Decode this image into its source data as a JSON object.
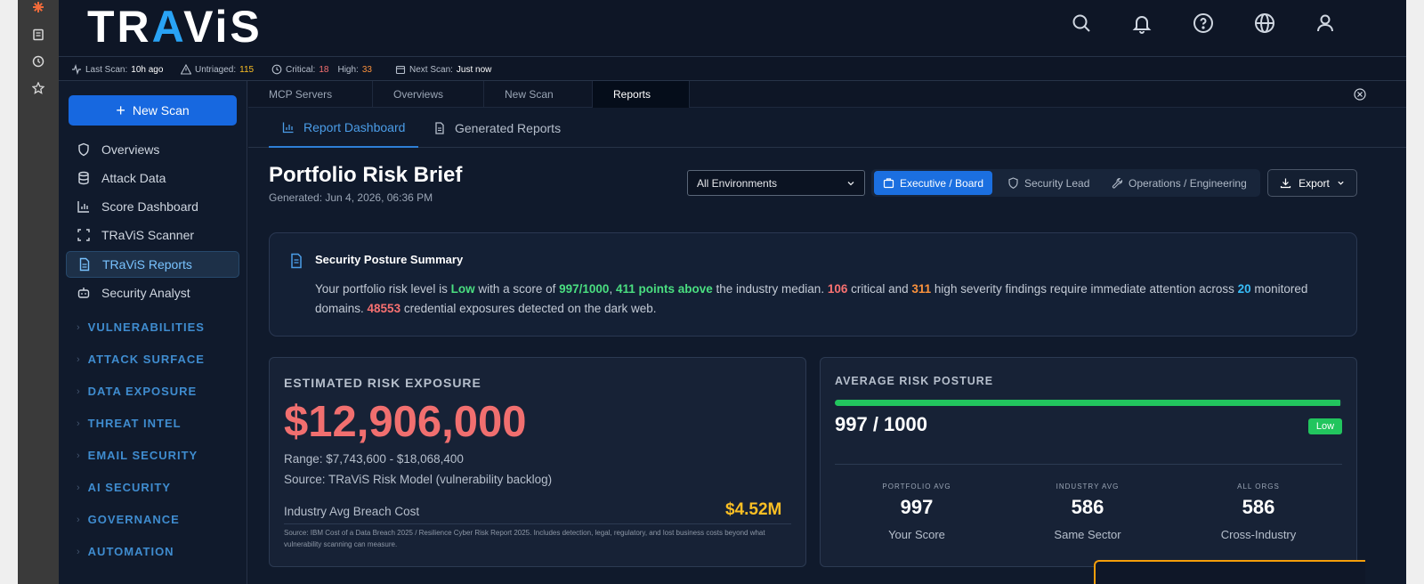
{
  "app": {
    "logo_left": "TR",
    "logo_accent": "A",
    "logo_right": "ViS"
  },
  "icons": {
    "rail": [
      "brand-star-icon",
      "document-icon",
      "clock-icon",
      "star-icon"
    ],
    "top": [
      "search-icon",
      "bell-icon",
      "help-icon",
      "globe-icon",
      "user-icon"
    ]
  },
  "statusbar": {
    "last_scan_label": "Last Scan:",
    "last_scan_value": "10h ago",
    "untriaged_label": "Untriaged:",
    "untriaged_value": "115",
    "critical_label": "Critical:",
    "critical_value": "18",
    "high_label": "High:",
    "high_value": "33",
    "next_scan_label": "Next Scan:",
    "next_scan_value": "Just now"
  },
  "sidebar": {
    "new_scan": "New Scan",
    "items": [
      {
        "label": "Overviews",
        "icon": "shield-icon"
      },
      {
        "label": "Attack Data",
        "icon": "database-icon"
      },
      {
        "label": "Score Dashboard",
        "icon": "chart-icon"
      },
      {
        "label": "TRaViS Scanner",
        "icon": "scan-frame-icon"
      },
      {
        "label": "TRaViS Reports",
        "icon": "report-icon",
        "active": true
      },
      {
        "label": "Security Analyst",
        "icon": "bot-icon"
      }
    ],
    "sections": [
      "VULNERABILITIES",
      "ATTACK SURFACE",
      "DATA EXPOSURE",
      "THREAT INTEL",
      "EMAIL SECURITY",
      "AI SECURITY",
      "GOVERNANCE",
      "AUTOMATION"
    ]
  },
  "tabs": [
    "MCP Servers",
    "Overviews",
    "New Scan",
    "Reports"
  ],
  "subtabs": [
    "Report Dashboard",
    "Generated Reports"
  ],
  "page": {
    "title": "Portfolio Risk Brief",
    "generated": "Generated: Jun 4, 2026, 06:36 PM",
    "env_select": "All Environments",
    "views": [
      "Executive / Board",
      "Security Lead",
      "Operations / Engineering"
    ],
    "export": "Export"
  },
  "summary": {
    "title": "Security Posture Summary",
    "t1": "Your portfolio risk level is ",
    "risk_level": "Low",
    "t2": " with a score of ",
    "score": "997/1000",
    "t3": ", ",
    "above": "411 points above",
    "t4": " the industry median. ",
    "critical": "106",
    "t5": " critical and ",
    "high": "311",
    "t6": " high severity findings require immediate attention across ",
    "domains": "20",
    "t7": " monitored domains. ",
    "exposures": "48553",
    "t8": " credential exposures detected on the dark web."
  },
  "exposure_card": {
    "label": "ESTIMATED RISK EXPOSURE",
    "amount": "$12,906,000",
    "range": "Range: $7,743,600 - $18,068,400",
    "source": "Source: TRaViS Risk Model (vulnerability backlog)",
    "industry_label": "Industry Avg Breach Cost",
    "industry_value": "$4.52M",
    "note": "Source: IBM Cost of a Data Breach 2025 / Resilience Cyber Risk Report 2025. Includes detection, legal, regulatory, and lost business costs beyond what vulnerability scanning can measure."
  },
  "posture_card": {
    "label": "AVERAGE RISK POSTURE",
    "score_text": "997 / 1000",
    "score_fraction": 0.997,
    "badge": "Low",
    "stats": [
      {
        "label": "PORTFOLIO AVG",
        "value": "997",
        "sub": "Your Score"
      },
      {
        "label": "INDUSTRY AVG",
        "value": "586",
        "sub": "Same Sector"
      },
      {
        "label": "ALL ORGS",
        "value": "586",
        "sub": "Cross-Industry"
      }
    ]
  },
  "colors": {
    "accent": "#1b6fe0",
    "good": "#22c55e",
    "critical": "#f16f6f",
    "warning": "#fbbf24"
  }
}
